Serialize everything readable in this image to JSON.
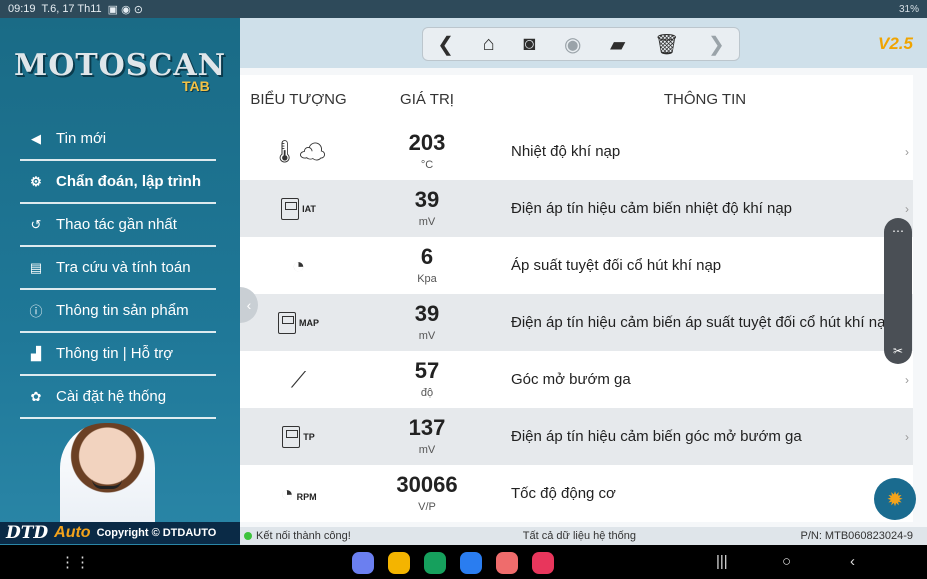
{
  "status_bar": {
    "time": "09:19",
    "date": "T.6, 17 Th11",
    "right": "31%"
  },
  "sidebar": {
    "logo": "MOTOSCAN",
    "logo_sub": "TAB",
    "items": [
      {
        "label": "Tin mới",
        "icon": "megaphone-icon",
        "glyph": "◀"
      },
      {
        "label": "Chẩn đoán, lập trình",
        "icon": "diagnosis-icon",
        "glyph": "⚙"
      },
      {
        "label": "Thao tác gần nhất",
        "icon": "history-icon",
        "glyph": "↺"
      },
      {
        "label": "Tra cứu và tính toán",
        "icon": "document-icon",
        "glyph": "▤"
      },
      {
        "label": "Thông tin sản phẩm",
        "icon": "info-icon",
        "glyph": "ⓘ"
      },
      {
        "label": "Thông tin | Hỗ trợ",
        "icon": "factory-icon",
        "glyph": "▟"
      },
      {
        "label": "Cài đặt hệ thống",
        "icon": "gear-icon",
        "glyph": "✿"
      }
    ],
    "brand": {
      "a": "DTD",
      "b": "Auto",
      "copyright": "Copyright © DTDAUTO"
    }
  },
  "toolbar": {
    "version": "V2.5"
  },
  "table": {
    "headers": [
      "BIỂU TƯỢNG",
      "GIÁ TRỊ",
      "THÔNG TIN"
    ],
    "rows": [
      {
        "symbol": "thermometer-cloud-icon",
        "sym_text": "",
        "value": "203",
        "unit": "°C",
        "info": "Nhiệt độ khí nạp"
      },
      {
        "symbol": "multimeter-icon",
        "sym_text": "IAT",
        "value": "39",
        "unit": "mV",
        "info": "Điện áp tín hiệu cảm biến nhiệt độ khí nạp"
      },
      {
        "symbol": "gauge-icon",
        "sym_text": "",
        "value": "6",
        "unit": "Kpa",
        "info": "Áp suất tuyệt đối cổ hút khí nạp"
      },
      {
        "symbol": "multimeter-icon",
        "sym_text": "MAP",
        "value": "39",
        "unit": "mV",
        "info": "Điện áp tín hiệu cảm biến áp suất tuyệt đối cổ hút khí nạp"
      },
      {
        "symbol": "throttle-icon",
        "sym_text": "",
        "value": "57",
        "unit": "độ",
        "info": "Góc mở bướm ga"
      },
      {
        "symbol": "multimeter-icon",
        "sym_text": "TP",
        "value": "137",
        "unit": "mV",
        "info": "Điện áp tín hiệu cảm biến góc mở bướm ga"
      },
      {
        "symbol": "rpm-gauge-icon",
        "sym_text": "RPM",
        "value": "30066",
        "unit": "V/P",
        "info": "Tốc độ động cơ"
      }
    ]
  },
  "footer": {
    "connection": "Kết nối thành công!",
    "center": "Tất cả dữ liệu hệ thống",
    "pn": "P/N: MTB060823024-9"
  },
  "colors": {
    "sidebar": "#1f7898",
    "accent": "#f0a400",
    "fab": "#1a6b8f"
  }
}
